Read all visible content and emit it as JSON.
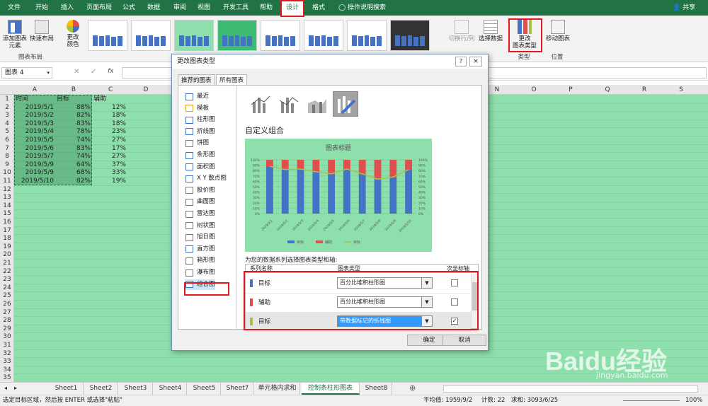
{
  "ribbon": {
    "tabs": [
      "文件",
      "开始",
      "插入",
      "页面布局",
      "公式",
      "数据",
      "审阅",
      "视图",
      "开发工具",
      "帮助",
      "设计",
      "格式"
    ],
    "active_tab": "设计",
    "search": "操作说明搜索",
    "share": "共享",
    "buttons": {
      "add_element": "添加图表\n元素",
      "quick_layout": "快速布局",
      "change_colors": "更改\n颜色",
      "switch_row_col": "切换行/列",
      "select_data": "选择数据",
      "change_type": "更改\n图表类型",
      "move_chart": "移动图表"
    },
    "groups": {
      "layout": "图表布局",
      "type": "类型",
      "location": "位置"
    }
  },
  "formula_bar": {
    "name_box": "图表 4",
    "fx": "fx"
  },
  "sheet": {
    "columns": [
      "A",
      "B",
      "C",
      "D",
      "E",
      "F",
      "G",
      "H",
      "I",
      "J",
      "K",
      "L",
      "M",
      "N",
      "O",
      "P",
      "Q",
      "R",
      "S",
      "T"
    ],
    "visible_columns_right": [
      "N",
      "O",
      "P",
      "Q",
      "R",
      "S"
    ],
    "headers": [
      "时间",
      "目标",
      "辅助"
    ],
    "rows": [
      [
        "2019/5/1",
        "88%",
        "12%"
      ],
      [
        "2019/5/2",
        "82%",
        "18%"
      ],
      [
        "2019/5/3",
        "83%",
        "18%"
      ],
      [
        "2019/5/4",
        "78%",
        "23%"
      ],
      [
        "2019/5/5",
        "74%",
        "27%"
      ],
      [
        "2019/5/6",
        "83%",
        "17%"
      ],
      [
        "2019/5/7",
        "74%",
        "27%"
      ],
      [
        "2019/5/9",
        "64%",
        "37%"
      ],
      [
        "2019/5/9",
        "68%",
        "33%"
      ],
      [
        "2019/5/10",
        "82%",
        "19%"
      ]
    ],
    "row_count": 35
  },
  "sheet_tabs": [
    "Sheet1",
    "Sheet2",
    "Sheet3",
    "Sheet4",
    "Sheet5",
    "Sheet7",
    "单元格内求和",
    "控制条柱形图表",
    "Sheet8"
  ],
  "active_sheet": "控制条柱形图表",
  "status": {
    "message": "选定目标区域，然后按 ENTER 或选择\"粘贴\"",
    "average": "平均值: 1959/9/2",
    "count": "计数: 22",
    "sum": "求和: 3093/6/25",
    "zoom": "100%"
  },
  "dialog": {
    "title": "更改图表类型",
    "help": "?",
    "close": "×",
    "tabs": [
      "推荐的图表",
      "所有图表"
    ],
    "active_tab": "所有图表",
    "chart_types": [
      "最近",
      "模板",
      "柱形图",
      "折线图",
      "饼图",
      "条形图",
      "面积图",
      "X Y 散点图",
      "股价图",
      "曲面图",
      "雷达图",
      "树状图",
      "旭日图",
      "直方图",
      "箱形图",
      "瀑布图",
      "组合图"
    ],
    "selected_type": "组合图",
    "section_title": "自定义组合",
    "series_prompt": "为您的数据系列选择图表类型和轴:",
    "table_headers": [
      "系列名称",
      "图表类型",
      "次坐标轴"
    ],
    "series": [
      {
        "name": "目标",
        "type": "百分比堆积柱形图",
        "secondary": false,
        "color": "#4472c4"
      },
      {
        "name": "辅助",
        "type": "百分比堆积柱形图",
        "secondary": false,
        "color": "#e04e4e"
      },
      {
        "name": "目标",
        "type": "带数据标记的折线图",
        "secondary": true,
        "color": "#a5c34a"
      }
    ],
    "ok": "确定",
    "cancel": "取消"
  },
  "chart_data": {
    "type": "bar",
    "title": "图表标题",
    "categories": [
      "2019/5/1",
      "2019/5/2",
      "2019/5/3",
      "2019/5/4",
      "2019/5/5",
      "2019/5/6",
      "2019/5/7",
      "2019/5/8",
      "2019/5/9",
      "2019/5/10"
    ],
    "series": [
      {
        "name": "目标",
        "values": [
          88,
          82,
          83,
          78,
          74,
          83,
          74,
          64,
          68,
          82
        ],
        "color": "#4472c4"
      },
      {
        "name": "辅助",
        "values": [
          12,
          18,
          18,
          23,
          27,
          17,
          27,
          37,
          33,
          19
        ],
        "color": "#e04e4e"
      },
      {
        "name": "目标",
        "values": [
          88,
          82,
          83,
          78,
          74,
          83,
          74,
          64,
          68,
          82
        ],
        "color": "#a5c34a",
        "kind": "line"
      }
    ],
    "y_ticks": [
      "0%",
      "10%",
      "20%",
      "30%",
      "40%",
      "50%",
      "60%",
      "70%",
      "80%",
      "90%",
      "100%"
    ],
    "ylim": [
      0,
      100
    ],
    "legend": "bottom"
  },
  "watermark": {
    "text": "Baidu经验",
    "url": "jingyan.baidu.com"
  }
}
